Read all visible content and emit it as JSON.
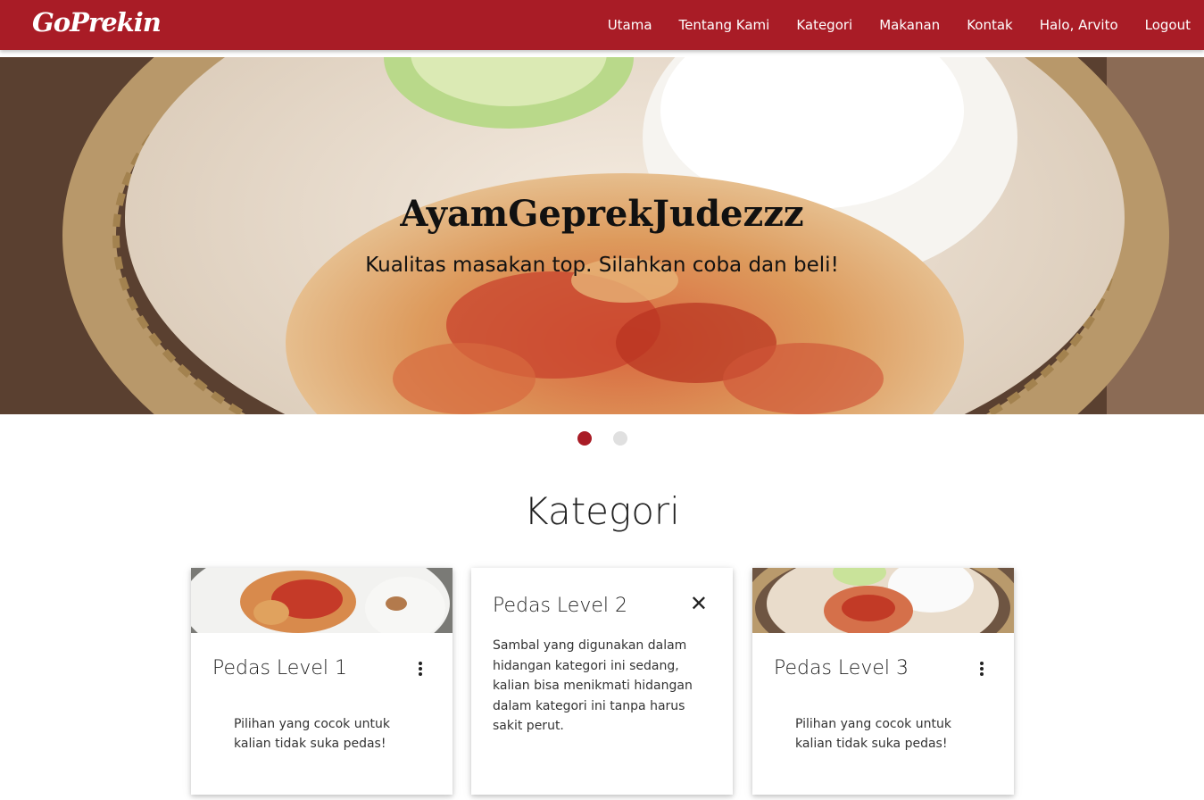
{
  "brand": {
    "logo": "GoPrekin",
    "primary_color": "#a91c26"
  },
  "nav": {
    "items": [
      "Utama",
      "Tentang Kami",
      "Kategori",
      "Makanan",
      "Kontak",
      "Halo, Arvito",
      "Logout"
    ]
  },
  "hero": {
    "title": "AyamGeprekJudezzz",
    "subtitle": "Kualitas masakan top. Silahkan coba dan beli!",
    "slides": 2,
    "active_slide": 1
  },
  "categories": {
    "heading": "Kategori",
    "cards": [
      {
        "title": "Pedas Level 1",
        "text": "Pilihan yang cocok untuk kalian tidak suka pedas!",
        "state": "default"
      },
      {
        "title": "Pedas Level 2",
        "text": "Sambal yang digunakan dalam hidangan kategori ini sedang, kalian bisa menikmati hidangan dalam kategori ini tanpa harus sakit perut.",
        "state": "revealed",
        "close_icon": "close-icon"
      },
      {
        "title": "Pedas Level 3",
        "text": "Pilihan yang cocok untuk kalian tidak suka pedas!",
        "state": "default"
      }
    ]
  }
}
